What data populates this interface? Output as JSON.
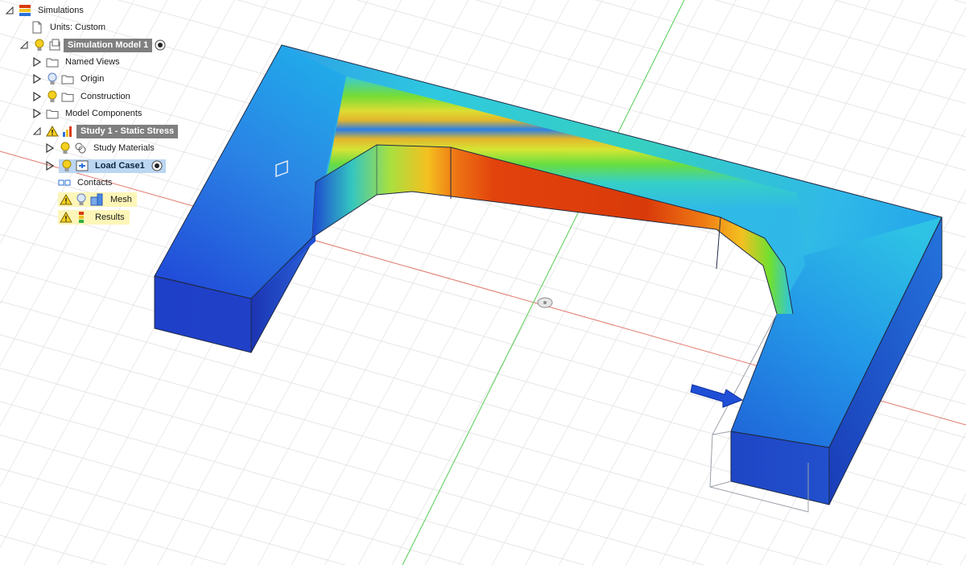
{
  "browser_tree": {
    "root": {
      "label": "Simulations",
      "icon": "simulations-icon",
      "expanded": true
    },
    "units": {
      "label": "Units: Custom",
      "icon": "document-icon"
    },
    "model": {
      "label": "Simulation Model 1",
      "icon": "component-icon",
      "active_marker": "radio-active-icon"
    },
    "named_views": {
      "label": "Named Views",
      "icon": "folder-icon"
    },
    "origin": {
      "label": "Origin",
      "icon": "folder-icon",
      "visibility": "lightbulb-off-icon"
    },
    "construction": {
      "label": "Construction",
      "icon": "folder-icon",
      "visibility": "lightbulb-on-icon"
    },
    "model_components": {
      "label": "Model Components",
      "icon": "folder-icon"
    },
    "study": {
      "label": "Study 1 - Static Stress",
      "icon": "study-icon",
      "status": "warning-icon"
    },
    "study_materials": {
      "label": "Study Materials",
      "icon": "materials-icon"
    },
    "load_case": {
      "label": "Load Case1",
      "icon": "load-case-icon",
      "active_marker": "radio-active-icon"
    },
    "contacts": {
      "label": "Contacts",
      "icon": "contacts-icon"
    },
    "mesh": {
      "label": "Mesh",
      "icon": "mesh-icon",
      "status": "warning-icon"
    },
    "results": {
      "label": "Results",
      "icon": "results-icon",
      "status": "warning-icon"
    }
  },
  "colors": {
    "high_stress": "#d93a0a",
    "mid_stress": "#7fe020",
    "low_stress": "#1d4cd0",
    "warning_highlight": "#fdf6b8",
    "selection": "#bcd6f2",
    "x_axis": "#e07a6e",
    "y_axis": "#55cc55"
  },
  "viewport": {
    "load_arrow": "load-arrow-icon",
    "origin_marker": "origin-marker-icon"
  }
}
